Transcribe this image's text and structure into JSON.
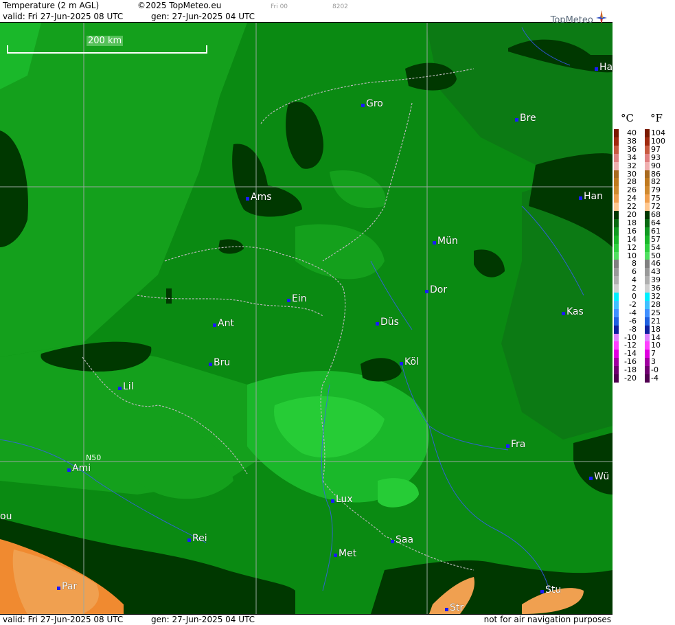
{
  "header": {
    "title": "Temperature (2 m AGL)",
    "copyright": "©2025 TopMeteo.eu",
    "run_label": "Fri 00",
    "code": "8202",
    "valid": "valid:  Fri  27-Jun-2025  08 UTC",
    "gen": "gen:  27-Jun-2025 04 UTC",
    "logo": "TopMeteo"
  },
  "map": {
    "scale_label": "200 km",
    "lat_label": "N50",
    "cities": [
      {
        "name": "Ha"
      },
      {
        "name": "Gro"
      },
      {
        "name": "Bre"
      },
      {
        "name": "Ams"
      },
      {
        "name": "Han"
      },
      {
        "name": "Mün"
      },
      {
        "name": "Dor"
      },
      {
        "name": "Ein"
      },
      {
        "name": "Kas"
      },
      {
        "name": "Düs"
      },
      {
        "name": "Ant"
      },
      {
        "name": "Köl"
      },
      {
        "name": "Bru"
      },
      {
        "name": "Lil"
      },
      {
        "name": "Fra"
      },
      {
        "name": "Ami"
      },
      {
        "name": "Wü"
      },
      {
        "name": "Lux"
      },
      {
        "name": "ou"
      },
      {
        "name": "Rei"
      },
      {
        "name": "Saa"
      },
      {
        "name": "Met"
      },
      {
        "name": "Par"
      },
      {
        "name": "Stu"
      },
      {
        "name": "Str"
      }
    ]
  },
  "footer": {
    "valid": "valid:  Fri  27-Jun-2025  08 UTC",
    "gen": "gen:  27-Jun-2025 04 UTC",
    "disclaimer": "not for air navigation purposes"
  },
  "legend": {
    "unit_c": "°C",
    "unit_f": "°F",
    "celsius": [
      "40",
      "38",
      "36",
      "34",
      "32",
      "30",
      "28",
      "26",
      "24",
      "22",
      "20",
      "18",
      "16",
      "14",
      "12",
      "10",
      "8",
      "6",
      "4",
      "2",
      "0",
      "-2",
      "-4",
      "-6",
      "-8",
      "-10",
      "-12",
      "-14",
      "-16",
      "-18",
      "-20"
    ],
    "fahrenheit": [
      "104",
      "100",
      "97",
      "93",
      "90",
      "86",
      "82",
      "79",
      "75",
      "72",
      "68",
      "64",
      "61",
      "57",
      "54",
      "50",
      "46",
      "43",
      "39",
      "36",
      "32",
      "28",
      "25",
      "21",
      "18",
      "14",
      "10",
      "7",
      "3",
      "-0",
      "-4"
    ],
    "colors": [
      "#7a1a00",
      "#a02a10",
      "#c85a40",
      "#e08080",
      "#f0b0b0",
      "#a86a20",
      "#c07a20",
      "#d08a30",
      "#f0a050",
      "#ffc890",
      "#003800",
      "#0a6a12",
      "#129a22",
      "#1ab82a",
      "#30d040",
      "#50e060",
      "#808080",
      "#9a9a9a",
      "#b0b0b0",
      "#d0d0d0",
      "#00f0ff",
      "#40c0ff",
      "#4090ff",
      "#2060e0",
      "#1020a0",
      "#e080ff",
      "#ff40ff",
      "#e000e0",
      "#a000a0",
      "#700070",
      "#500050"
    ]
  }
}
